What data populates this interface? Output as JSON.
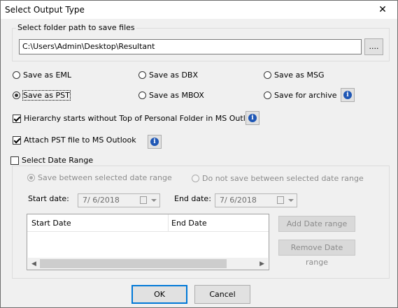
{
  "window": {
    "title": "Select Output Type",
    "close_glyph": "✕"
  },
  "folder_group": {
    "label": "Select folder path to save files",
    "path_value": "C:\\Users\\Admin\\Desktop\\Resultant",
    "browse_label": "...."
  },
  "save_options": [
    {
      "label": "Save as EML",
      "selected": false
    },
    {
      "label": "Save as DBX",
      "selected": false
    },
    {
      "label": "Save as MSG",
      "selected": false
    },
    {
      "label": "Save as PST",
      "selected": true
    },
    {
      "label": "Save as MBOX",
      "selected": false
    },
    {
      "label": "Save for archive",
      "selected": false
    }
  ],
  "checkboxes": {
    "hierarchy": {
      "label": "Hierarchy starts without Top of Personal Folder in MS Outlook",
      "checked": true
    },
    "attach_pst": {
      "label": "Attach PST file to MS Outlook",
      "checked": true
    }
  },
  "date_range": {
    "label": "Select Date Range",
    "checked": false,
    "save_between": "Save between selected date range",
    "do_not_save_between": "Do not save between selected date range",
    "start_label": "Start date:",
    "start_value": "7/  6/2018",
    "end_label": "End date:",
    "end_value": "7/  6/2018",
    "columns": [
      "Start Date",
      "End Date"
    ],
    "add_label": "Add Date range",
    "remove_label": "Remove Date range"
  },
  "buttons": {
    "ok": "OK",
    "cancel": "Cancel"
  },
  "colors": {
    "info_icon": "#1f57b5",
    "ok_border": "#0078d7"
  }
}
